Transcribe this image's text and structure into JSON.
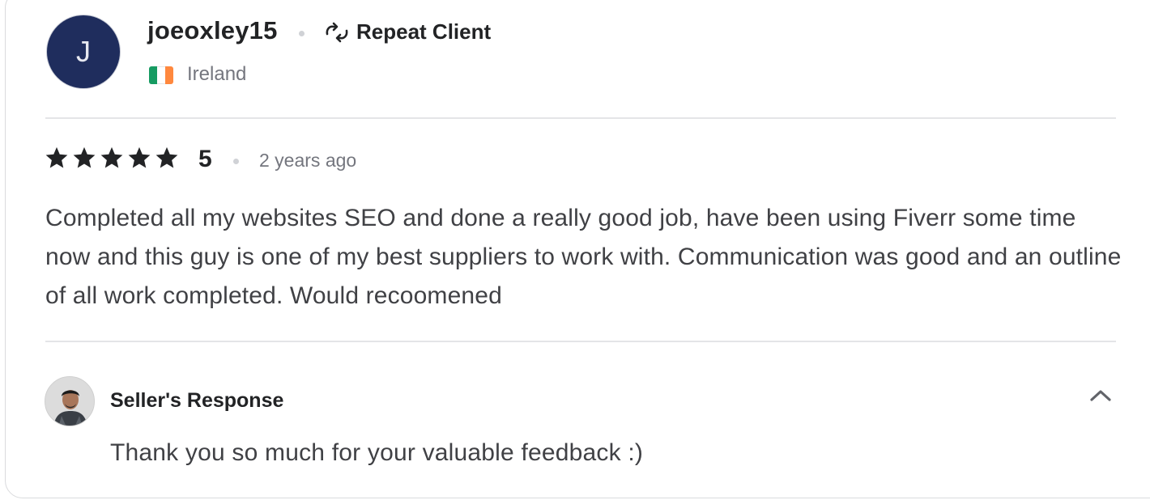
{
  "reviewer": {
    "initial": "J",
    "avatar_color": "#1f2d5d",
    "username": "joeoxley15",
    "badge_icon": "repeat-icon",
    "badge_label": "Repeat Client",
    "country": "Ireland",
    "flag_colors": [
      "#169b62",
      "#ffffff",
      "#ff883e"
    ]
  },
  "rating": {
    "stars": 5,
    "value": "5",
    "time_ago": "2 years ago"
  },
  "review": {
    "text": "Completed all my websites SEO and done a really good job, have been using Fiverr some time now and this guy is one of my best suppliers to work with. Communication was good and an outline of all work completed. Would recoomened"
  },
  "seller_response": {
    "label": "Seller's Response",
    "text": "Thank you so much for your valuable feedback :)",
    "toggle_icon": "chevron-up-icon"
  }
}
